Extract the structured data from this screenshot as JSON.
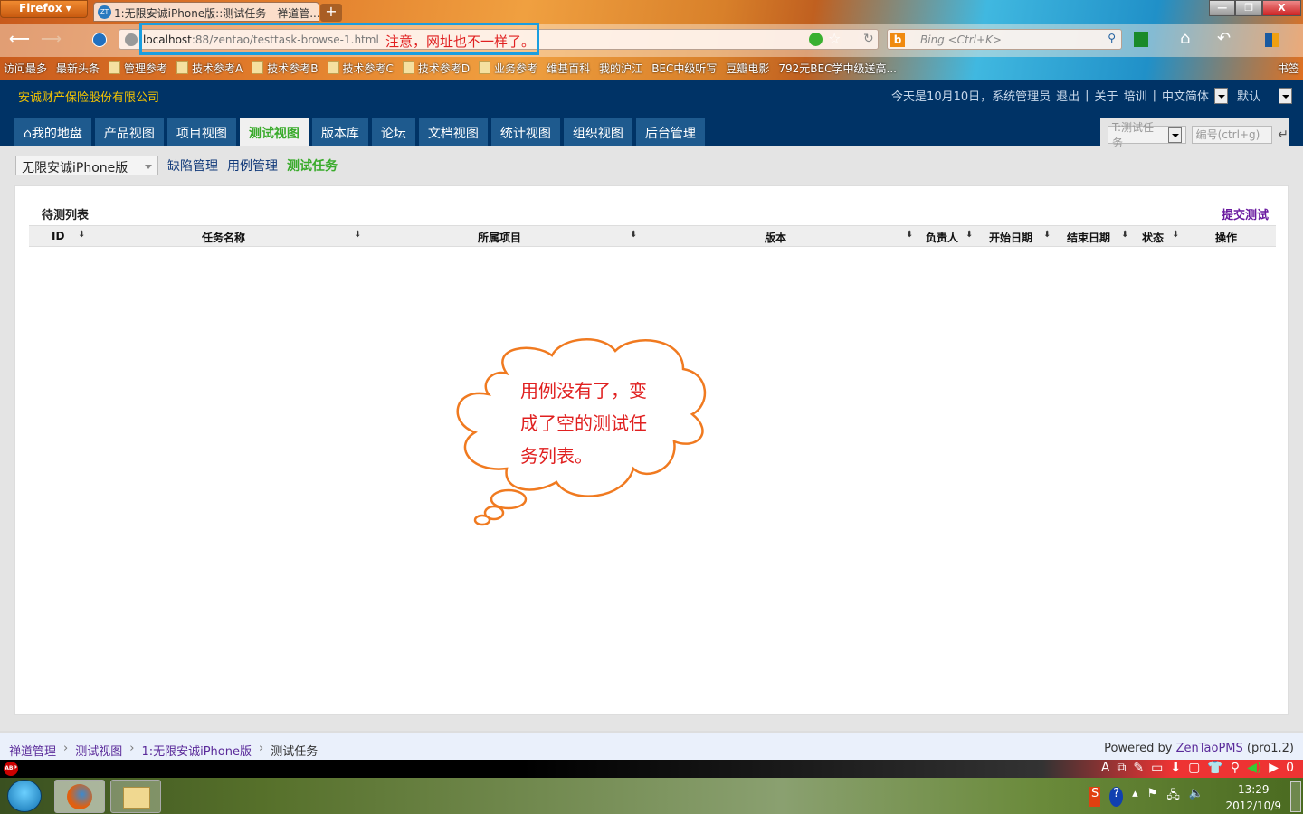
{
  "browser": {
    "menu_label": "Firefox ▾",
    "tab_title": "1:无限安诚iPhone版::测试任务 - 禅道管...",
    "new_tab": "+",
    "url_host": "localhost",
    "url_path": ":88/zentao/testtask-browse-1.html",
    "search_placeholder": "Bing <Ctrl+K>",
    "window_controls": [
      "—",
      "❐",
      "X"
    ],
    "bookmarks": [
      "访问最多",
      "最新头条",
      "管理参考",
      "技术参考A",
      "技术参考B",
      "技术参考C",
      "技术参考D",
      "业务参考",
      "维基百科",
      "我的沪江",
      "BEC中级听写",
      "豆瓣电影",
      "792元BEC学中级送高..."
    ],
    "bookmarks_menu": "书签"
  },
  "annotation": {
    "url_note": "注意，网址也不一样了。",
    "callout_lines": [
      "用例没有了，变",
      "成了空的测试任",
      "务列表。"
    ],
    "accent": "#1a9ee0",
    "cloud_color": "#f07a20"
  },
  "header": {
    "company": "安诚财产保险股份有限公司",
    "greeting": "今天是10月10日，系统管理员",
    "logout": "退出",
    "about": "关于",
    "training": "培训",
    "language": "中文简体",
    "theme": "默认"
  },
  "nav": {
    "tabs": [
      "我的地盘",
      "产品视图",
      "项目视图",
      "测试视图",
      "版本库",
      "论坛",
      "文档视图",
      "统计视图",
      "组织视图",
      "后台管理"
    ],
    "active": 3,
    "quick_type": "T:测试任务",
    "quick_placeholder": "编号(ctrl+g)"
  },
  "subnav": {
    "product": "无限安诚iPhone版",
    "links": [
      "缺陷管理",
      "用例管理",
      "测试任务"
    ],
    "active": 2
  },
  "panel": {
    "title": "待测列表",
    "submit": "提交测试",
    "columns": [
      "ID",
      "任务名称",
      "所属项目",
      "版本",
      "负责人",
      "开始日期",
      "结束日期",
      "状态",
      "操作"
    ],
    "rows": []
  },
  "footer": {
    "breadcrumb": [
      "禅道管理",
      "测试视图",
      "1:无限安诚iPhone版",
      "测试任务"
    ],
    "powered_prefix": "Powered by ",
    "powered_link": "ZenTaoPMS",
    "powered_version": " (pro1.2)"
  },
  "taskbar": {
    "time": "13:29",
    "date": "2012/10/9",
    "addon_count": "0"
  }
}
